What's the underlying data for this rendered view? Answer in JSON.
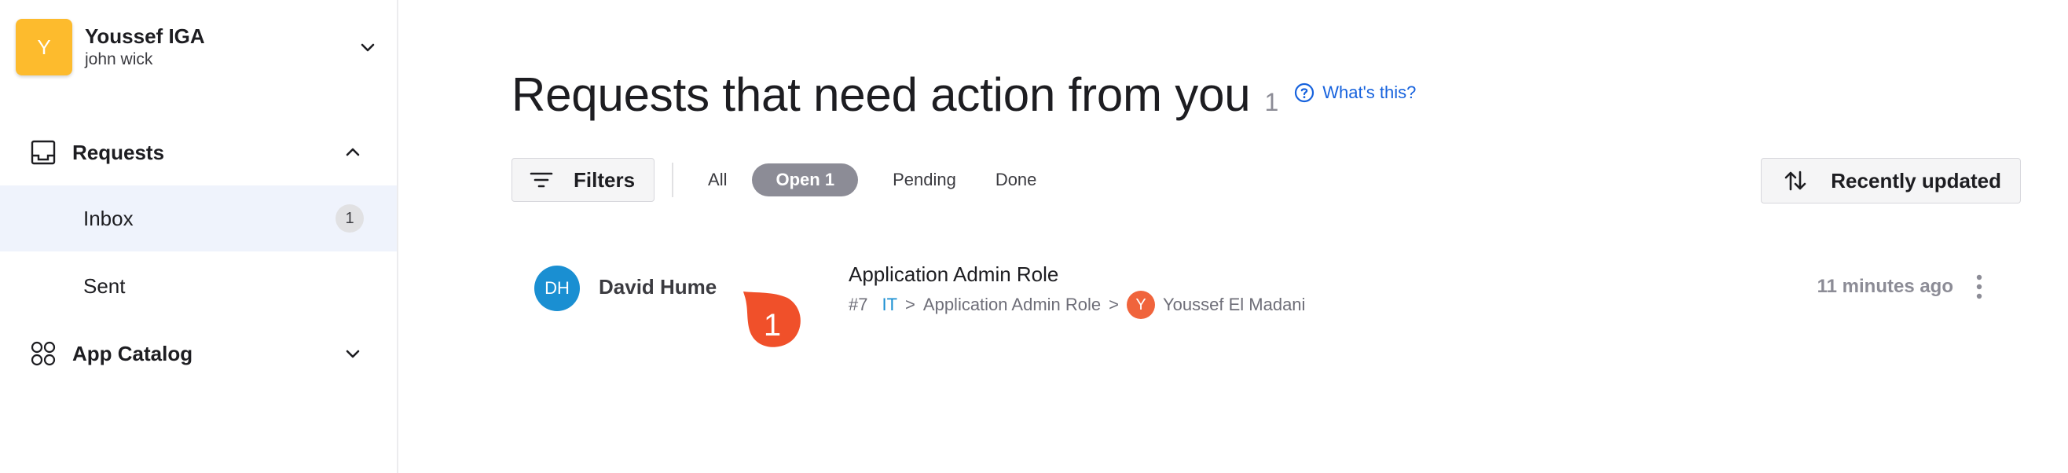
{
  "account": {
    "avatar_letter": "Y",
    "name": "Youssef IGA",
    "sub": "john wick",
    "avatar_color": "#fdbb2d"
  },
  "sidebar": {
    "requests_label": "Requests",
    "inbox_label": "Inbox",
    "inbox_count": "1",
    "sent_label": "Sent",
    "app_catalog_label": "App Catalog"
  },
  "header": {
    "title": "Requests that need action from you",
    "count": "1",
    "whats_this": "What's this?"
  },
  "filters": {
    "filters_label": "Filters",
    "tabs": [
      "All",
      "Open 1",
      "Pending",
      "Done"
    ],
    "selected_tab": "Open 1",
    "sort_label": "Recently updated"
  },
  "request": {
    "requester_initials": "DH",
    "requester_name": "David Hume",
    "marker_number": "1",
    "title": "Application Admin Role",
    "id": "#7",
    "path_app": "IT",
    "path_sep1": ">",
    "path_role": "Application Admin Role",
    "path_sep2": ">",
    "assignee_initial": "Y",
    "assignee_name": "Youssef El Madani",
    "time": "11 minutes ago"
  },
  "colors": {
    "accent_blue": "#1662dd",
    "active_nav_bg": "#eff3fc",
    "marker_red": "#f0502a",
    "dh_avatar": "#1a8fd2",
    "assignee_avatar": "#f0643c"
  },
  "icons": [
    "chevron-down-icon",
    "inbox-tray-icon",
    "chevron-up-icon",
    "app-grid-icon",
    "help-circle-icon",
    "filter-lines-icon",
    "sort-arrows-icon",
    "kebab-menu-icon"
  ]
}
